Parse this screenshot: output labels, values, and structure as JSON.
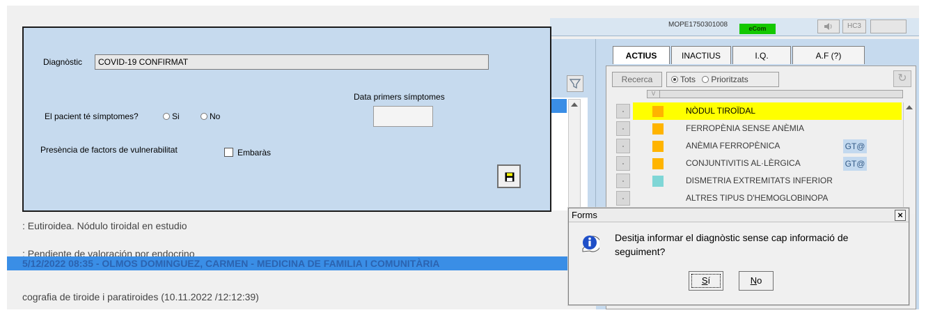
{
  "status_strip": {
    "record_code": "MOPE1750301008",
    "green_badge": "eCom",
    "buttons": [
      "HC3",
      ""
    ]
  },
  "diag_form": {
    "diagnostic_label": "Diagnòstic",
    "diagnostic_value": "COVID-19 CONFIRMAT",
    "date_label": "Data primers símptomes",
    "date_value": "",
    "symptoms_question": "El pacient té símptomes?",
    "option_yes": "Si",
    "option_no": "No",
    "vulnerability_label": "Presència de factors de vulnerabilitat",
    "pregnancy_label": "Embaràs"
  },
  "notes": {
    "line1": ": Eutiroidea. Nódulo tiroidal en estudio",
    "line2": ": Pendiente de valoración por endocrino",
    "highlight": "5/12/2022 08:35 - OLMOS DOMINGUEZ, CARMEN - MEDICINA DE FAMILIA I COMUNITÀRIA",
    "line3": "cografia de tiroide i paratiroides (10.11.2022 /12:12:39)"
  },
  "problems": {
    "tabs": [
      "ACTIUS",
      "INACTIUS",
      "I.Q.",
      "A.F (?)"
    ],
    "active_tab": "ACTIUS",
    "search_button": "Recerca",
    "filter_all": "Tots",
    "filter_priority": "Prioritzats",
    "col_v": "V",
    "rows": [
      {
        "label": "NÒDUL TIROÏDAL",
        "color": "#ffb400",
        "gt": "",
        "selected": true
      },
      {
        "label": "FERROPÈNIA SENSE ANÈMIA",
        "color": "#ffb400",
        "gt": "",
        "selected": false
      },
      {
        "label": "ANÈMIA FERROPÈNICA",
        "color": "#ffb400",
        "gt": "GT@",
        "selected": false
      },
      {
        "label": "CONJUNTIVITIS AL·LÈRGICA",
        "color": "#ffb400",
        "gt": "GT@",
        "selected": false
      },
      {
        "label": "DISMETRIA EXTREMITATS INFERIOR",
        "color": "#7fd6d6",
        "gt": "",
        "selected": false
      },
      {
        "label": "ALTRES TIPUS D'HEMOGLOBINOPA",
        "color": "",
        "gt": "",
        "selected": false
      }
    ]
  },
  "dialog": {
    "title": "Forms",
    "message": "Desitja informar el diagnòstic sense cap informació de seguiment?",
    "yes_label": "Sí",
    "no_label": "No",
    "icon": "info-icon"
  }
}
